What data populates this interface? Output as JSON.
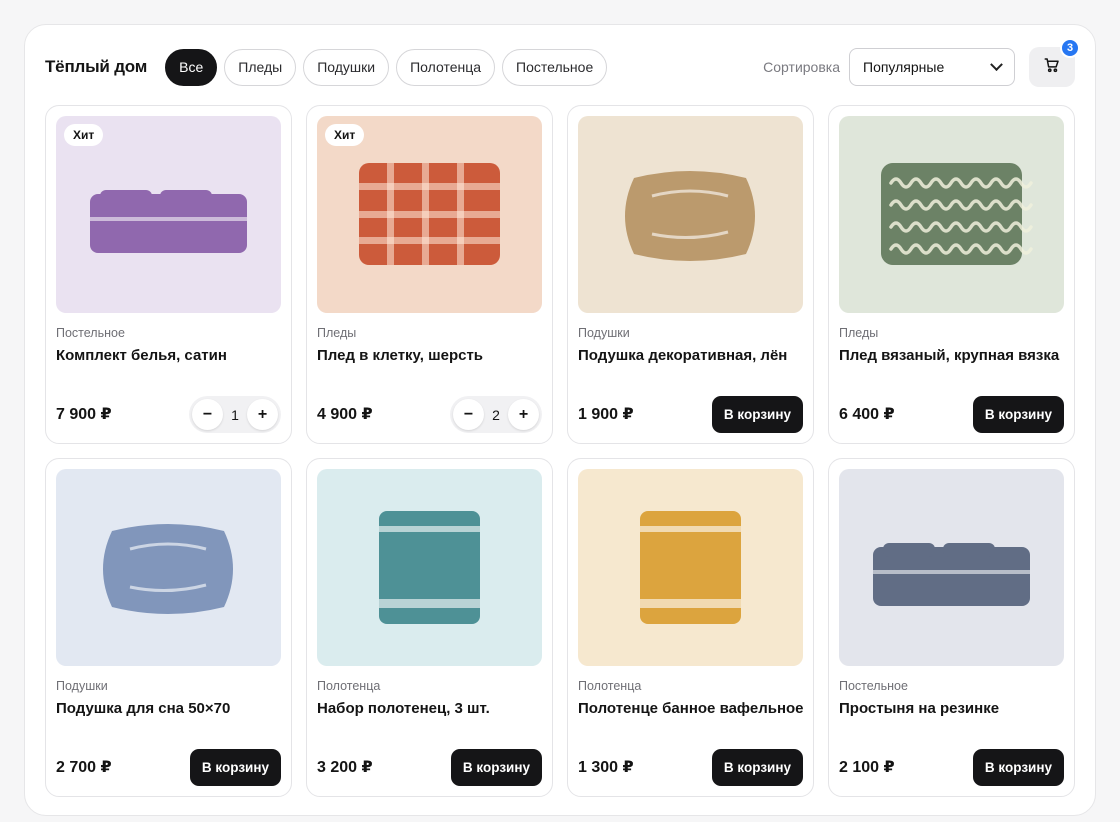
{
  "brand": "Тёплый дом",
  "filters": [
    {
      "label": "Все",
      "active": true
    },
    {
      "label": "Пледы",
      "active": false
    },
    {
      "label": "Подушки",
      "active": false
    },
    {
      "label": "Полотенца",
      "active": false
    },
    {
      "label": "Постельное",
      "active": false
    }
  ],
  "sort": {
    "label": "Сортировка",
    "selected": "Популярные"
  },
  "cart": {
    "count": "3",
    "icon": "cart-icon"
  },
  "add_label": "В корзину",
  "products": [
    {
      "category": "Постельное",
      "title": "Комплект белья, сатин",
      "price": "7 900 ₽",
      "badge": "Хит",
      "qty": "1",
      "bg": "#eae2f1",
      "color": "#9068ae",
      "art": "bedding"
    },
    {
      "category": "Пледы",
      "title": "Плед в клетку, шерсть",
      "price": "4 900 ₽",
      "badge": "Хит",
      "qty": "2",
      "bg": "#f3d9c8",
      "color": "#cc5b3b",
      "art": "plaid"
    },
    {
      "category": "Подушки",
      "title": "Подушка декоративная, лён",
      "price": "1 900 ₽",
      "bg": "#eee3d2",
      "color": "#bb9a6d",
      "art": "pillow"
    },
    {
      "category": "Пледы",
      "title": "Плед вязаный, крупная вязка",
      "price": "6 400 ₽",
      "bg": "#dfe6da",
      "color": "#6c8266",
      "art": "knit"
    },
    {
      "category": "Подушки",
      "title": "Подушка для сна 50×70",
      "price": "2 700 ₽",
      "bg": "#e2e8f2",
      "color": "#8196bb",
      "art": "pillow"
    },
    {
      "category": "Полотенца",
      "title": "Набор полотенец, 3 шт.",
      "price": "3 200 ₽",
      "bg": "#daecee",
      "color": "#4e9196",
      "art": "towel"
    },
    {
      "category": "Полотенца",
      "title": "Полотенце банное вафельное",
      "price": "1 300 ₽",
      "bg": "#f6e8cf",
      "color": "#dca43e",
      "art": "towel"
    },
    {
      "category": "Постельное",
      "title": "Простыня на резинке",
      "price": "2 100 ₽",
      "bg": "#e3e5ec",
      "color": "#616d85",
      "art": "bedding"
    }
  ]
}
